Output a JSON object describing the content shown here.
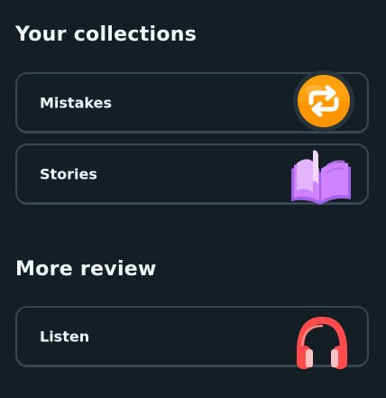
{
  "collections": {
    "title": "Your collections",
    "items": [
      {
        "label": "Mistakes",
        "icon": "refresh-arrows-icon",
        "accent": "#ff9600"
      },
      {
        "label": "Stories",
        "icon": "open-book-icon",
        "accent": "#ce82ff"
      }
    ]
  },
  "review": {
    "title": "More review",
    "items": [
      {
        "label": "Listen",
        "icon": "headphones-icon",
        "accent": "#ff4b4b"
      }
    ]
  },
  "colors": {
    "background": "#131f24",
    "card_border": "#37464f",
    "text": "#f1f7fb"
  }
}
